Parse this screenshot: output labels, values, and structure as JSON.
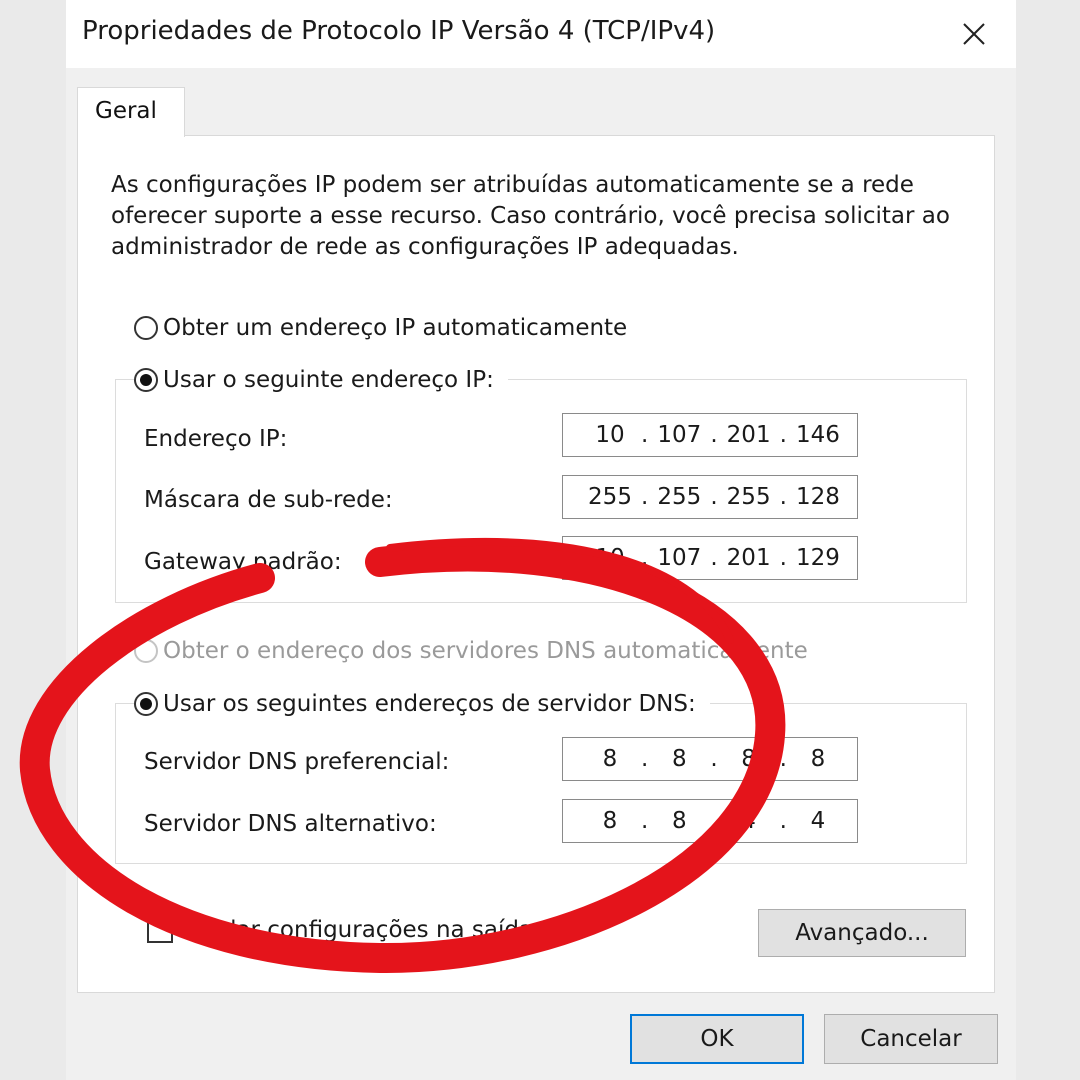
{
  "window": {
    "title": "Propriedades de Protocolo IP Versão 4 (TCP/IPv4)",
    "close_icon": "close-icon"
  },
  "tabs": [
    {
      "label": "Geral",
      "active": true
    }
  ],
  "description": "As configurações IP podem ser atribuídas automaticamente se a rede oferecer suporte a esse recurso. Caso contrário, você precisa solicitar ao administrador de rede as configurações IP adequadas.",
  "ip": {
    "auto_label": "Obter um endereço IP automaticamente",
    "auto_selected": false,
    "manual_label": "Usar o seguinte endereço IP:",
    "manual_selected": true,
    "fields": [
      {
        "label": "Endereço IP:",
        "octets": [
          "10",
          "107",
          "201",
          "146"
        ]
      },
      {
        "label": "Máscara de sub-rede:",
        "octets": [
          "255",
          "255",
          "255",
          "128"
        ]
      },
      {
        "label": "Gateway padrão:",
        "octets": [
          "10",
          "107",
          "201",
          "129"
        ]
      }
    ]
  },
  "dns": {
    "auto_label": "Obter o endereço dos servidores DNS automaticamente",
    "auto_selected": false,
    "auto_disabled": true,
    "manual_label": "Usar os seguintes endereços de servidor DNS:",
    "manual_selected": true,
    "fields": [
      {
        "label": "Servidor DNS preferencial:",
        "octets": [
          "8",
          "8",
          "8",
          "8"
        ]
      },
      {
        "label": "Servidor DNS alternativo:",
        "octets": [
          "8",
          "8",
          "4",
          "4"
        ]
      }
    ]
  },
  "validate_checkbox": {
    "label": "Validar configurações na saída",
    "checked": false
  },
  "buttons": {
    "advanced": "Avançado...",
    "ok": "OK",
    "cancel": "Cancelar"
  },
  "colors": {
    "annotation_red": "#e4141b",
    "primary_border": "#0078d7"
  }
}
